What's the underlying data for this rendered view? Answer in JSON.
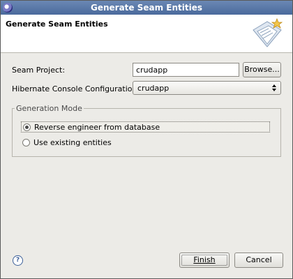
{
  "window": {
    "title": "Generate Seam Entities"
  },
  "header": {
    "title": "Generate Seam Entities"
  },
  "form": {
    "seam_project_label": "Seam Project:",
    "seam_project_value": "crudapp",
    "browse_label": "Browse...",
    "hibernate_label": "Hibernate Console Configuration:",
    "hibernate_value": "crudapp"
  },
  "generation_mode": {
    "legend": "Generation Mode",
    "options": [
      {
        "label": "Reverse engineer from database",
        "selected": true
      },
      {
        "label": "Use existing entities",
        "selected": false
      }
    ]
  },
  "footer": {
    "help_glyph": "?",
    "finish_label": "Finish",
    "cancel_label": "Cancel"
  },
  "colors": {
    "titlebar": "#5677aa",
    "background": "#ecebe7"
  },
  "icons": [
    "eclipse-icon",
    "wizard-banner-icon",
    "dropdown-arrows-icon",
    "help-icon"
  ]
}
